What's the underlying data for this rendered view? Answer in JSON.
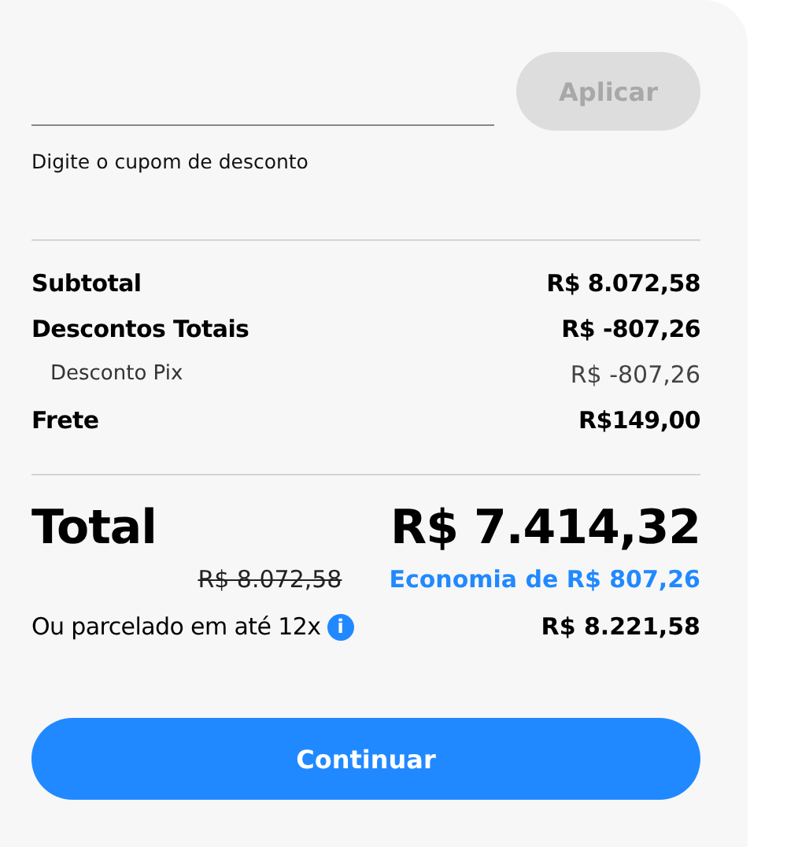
{
  "coupon": {
    "helper": "Digite o cupom de desconto",
    "apply_button": {
      "label": "Aplicar",
      "disabled": true
    }
  },
  "summary": [
    {
      "kind": "main",
      "label": "Subtotal",
      "value": "R$ 8.072,58"
    },
    {
      "kind": "main",
      "label": "Descontos Totais",
      "value": "R$ -807,26"
    },
    {
      "kind": "sub",
      "label": "Desconto Pix",
      "value": "R$ -807,26"
    },
    {
      "kind": "main",
      "label": "Frete",
      "value": "R$149,00"
    }
  ],
  "total": {
    "label": "Total",
    "value": "R$ 7.414,32",
    "old_price": "R$ 8.072,58",
    "savings": "Economia de R$ 807,26"
  },
  "installments": {
    "label": "Ou parcelado em até 12x",
    "info_icon": "i",
    "value": "R$ 8.221,58"
  },
  "continue_button": "Continuar"
}
